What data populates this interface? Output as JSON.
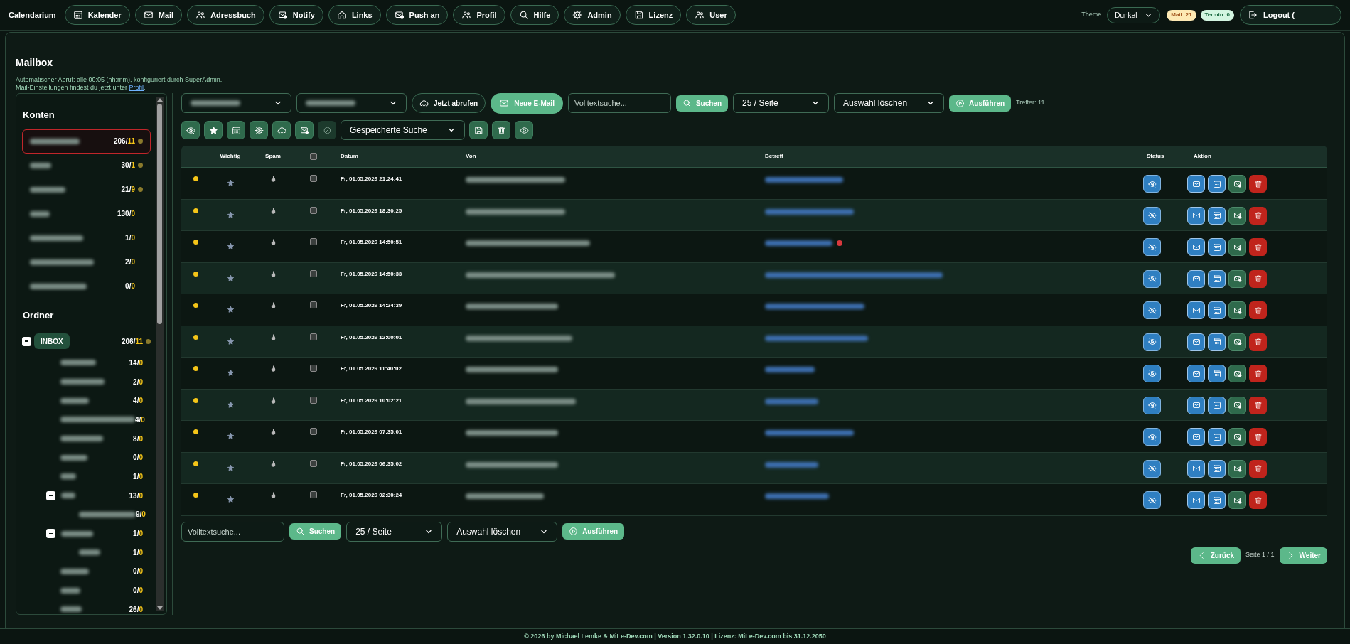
{
  "app": {
    "name": "Calendarium"
  },
  "nav": [
    "Kalender",
    "Mail",
    "Adressbuch",
    "Notify",
    "Links",
    "Push an",
    "Profil",
    "Hilfe",
    "Admin",
    "Lizenz",
    "User"
  ],
  "theme": {
    "label": "Theme",
    "value": "Dunkel"
  },
  "badges": [
    {
      "kind": "mail",
      "text": "Mail: 21"
    },
    {
      "kind": "termin",
      "text": "Termin: 0"
    }
  ],
  "logout": {
    "label": "Logout ("
  },
  "page": {
    "title": "Mailbox",
    "info_line1": "Automatischer Abruf: alle 00:05 (hh:mm), konfiguriert durch SuperAdmin.",
    "info_line2": "Mail-Einstellungen findest du jetzt unter ",
    "info_link": "Profil",
    "info_end": "."
  },
  "sidebar": {
    "accounts_title": "Konten",
    "accounts": [
      {
        "count": "206/",
        "unread": "11",
        "selected": true,
        "dot": true
      },
      {
        "count": "30/",
        "unread": "1",
        "selected": false,
        "dot": true
      },
      {
        "count": "21/",
        "unread": "9",
        "selected": false,
        "dot": true
      },
      {
        "count": "130/",
        "unread": "0",
        "selected": false,
        "dot": false
      },
      {
        "count": "1/",
        "unread": "0",
        "selected": false,
        "dot": false
      },
      {
        "count": "2/",
        "unread": "0",
        "selected": false,
        "dot": false
      },
      {
        "count": "0/",
        "unread": "0",
        "selected": false,
        "dot": false
      }
    ],
    "folders_title": "Ordner",
    "folders": [
      {
        "name": "INBOX",
        "count": "206/",
        "unread": "11",
        "dot": true,
        "expanded": true,
        "children": [
          {
            "count": "14/",
            "unread": "0"
          },
          {
            "count": "2/",
            "unread": "0"
          },
          {
            "count": "4/",
            "unread": "0"
          },
          {
            "count": "4/",
            "unread": "0"
          },
          {
            "count": "8/",
            "unread": "0"
          },
          {
            "count": "0/",
            "unread": "0"
          },
          {
            "count": "1/",
            "unread": "0"
          },
          {
            "count": "13/",
            "unread": "0",
            "expanded": true,
            "children": [
              {
                "count": "9/",
                "unread": "0"
              }
            ]
          },
          {
            "count": "1/",
            "unread": "0",
            "expanded": true,
            "children": [
              {
                "count": "1/",
                "unread": "0"
              }
            ]
          },
          {
            "count": "0/",
            "unread": "0"
          },
          {
            "count": "0/",
            "unread": "0"
          },
          {
            "count": "26/",
            "unread": "0"
          }
        ]
      }
    ]
  },
  "toolbar": {
    "fetch": "Jetzt abrufen",
    "new_mail": "Neue E-Mail",
    "search_placeholder": "Volltextsuche...",
    "search": "Suchen",
    "per_page": "25 / Seite",
    "bulk": "Auswahl löschen",
    "run": "Ausführen",
    "hits": "Treffer: 11",
    "saved_search": "Gespeicherte Suche"
  },
  "table": {
    "headers": {
      "important": "Wichtig",
      "spam": "Spam",
      "date": "Datum",
      "from": "Von",
      "subject": "Betreff",
      "status": "Status",
      "action": "Aktion"
    },
    "select_all": false,
    "rows": [
      {
        "date": "Fr, 01.05.2026 21:24:41",
        "unread": true,
        "important": false,
        "checked": false,
        "flagged": false
      },
      {
        "date": "Fr, 01.05.2026 18:30:25",
        "unread": true,
        "important": false,
        "checked": false,
        "flagged": false
      },
      {
        "date": "Fr, 01.05.2026 14:50:51",
        "unread": true,
        "important": false,
        "checked": false,
        "flagged": true
      },
      {
        "date": "Fr, 01.05.2026 14:50:33",
        "unread": true,
        "important": false,
        "checked": false,
        "flagged": false
      },
      {
        "date": "Fr, 01.05.2026 14:24:39",
        "unread": true,
        "important": false,
        "checked": false,
        "flagged": false
      },
      {
        "date": "Fr, 01.05.2026 12:00:01",
        "unread": true,
        "important": false,
        "checked": false,
        "flagged": false
      },
      {
        "date": "Fr, 01.05.2026 11:40:02",
        "unread": true,
        "important": false,
        "checked": false,
        "flagged": false
      },
      {
        "date": "Fr, 01.05.2026 10:02:21",
        "unread": true,
        "important": false,
        "checked": false,
        "flagged": false
      },
      {
        "date": "Fr, 01.05.2026 07:35:01",
        "unread": true,
        "important": false,
        "checked": false,
        "flagged": false
      },
      {
        "date": "Fr, 01.05.2026 06:35:02",
        "unread": true,
        "important": false,
        "checked": false,
        "flagged": false
      },
      {
        "date": "Fr, 01.05.2026 02:30:24",
        "unread": true,
        "important": false,
        "checked": false,
        "flagged": false
      }
    ]
  },
  "bottom_bar": {
    "search_placeholder": "Volltextsuche...",
    "search": "Suchen",
    "per_page": "25 / Seite",
    "bulk": "Auswahl löschen",
    "run": "Ausführen"
  },
  "pagination": {
    "prev": "Zurück",
    "page": "Seite 1 / 1",
    "next": "Weiter"
  },
  "footer": "© 2026 by Michael Lemke & MiLe-Dev.com | Version 1.32.0.10 | Lizenz: MiLe-Dev.com bis 31.12.2050"
}
